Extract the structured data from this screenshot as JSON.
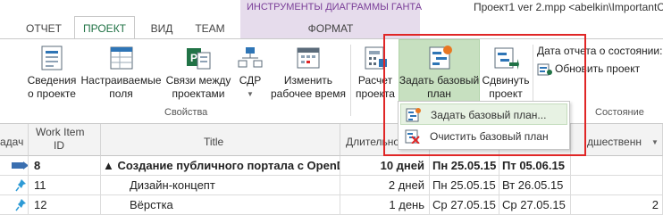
{
  "context_tab_header": "ИНСТРУМЕНТЫ ДИАГРАММЫ ГАНТА",
  "window_title": "Проект1 ver 2.mpp <abelkin\\ImportantCollec",
  "tabs": [
    {
      "label": "ОТЧЕТ"
    },
    {
      "label": "ПРОЕКТ",
      "active": true
    },
    {
      "label": "ВИД"
    },
    {
      "label": "TEAM"
    },
    {
      "label": "ФОРМАТ"
    }
  ],
  "ribbon": {
    "buttons": {
      "project_info": [
        "Сведения",
        "о проекте"
      ],
      "custom_fields": [
        "Настраиваемые",
        "поля"
      ],
      "links_between": [
        "Связи между",
        "проектами"
      ],
      "wbs": [
        "СДР"
      ],
      "change_worktime": [
        "Изменить",
        "рабочее время"
      ],
      "calc_project": [
        "Расчет",
        "проекта"
      ],
      "set_baseline": [
        "Задать базовый",
        "план"
      ],
      "move_project": [
        "Сдвинуть",
        "проект"
      ]
    },
    "group_properties": "Свойства",
    "group_status": "Состояние",
    "status_date_label": "Дата отчета о состоянии:",
    "update_project": "Обновить проект"
  },
  "dropdown": {
    "items": [
      {
        "label": "Задать базовый план...",
        "hover": true
      },
      {
        "label": "Очистить базовый план"
      }
    ]
  },
  "grid": {
    "headers": {
      "col0": "адач",
      "work_item": [
        "Work Item",
        "ID"
      ],
      "title": "Title",
      "duration": "Длительно",
      "right": "дшественн"
    },
    "rows": [
      {
        "work_item_id": "8",
        "title": "▲ Создание публичного портала с OpenD",
        "duration": "10 дней",
        "start": "Пн 25.05.15",
        "finish": "Пт 05.06.15",
        "pred": "",
        "summary": true
      },
      {
        "work_item_id": "11",
        "title": "Дизайн-концепт",
        "duration": "2 дней",
        "start": "Пн 25.05.15",
        "finish": "Вт 26.05.15",
        "pred": ""
      },
      {
        "work_item_id": "12",
        "title": "Вёрстка",
        "duration": "1 день",
        "start": "Ср 27.05.15",
        "finish": "Ср 27.05.15",
        "pred": "2"
      }
    ]
  },
  "colors": {
    "accent_green": "#217346",
    "context_tab": "#e6dcec",
    "context_text": "#7a3e98",
    "highlight_red": "#e02626",
    "baseline_button": "#c7e0c0"
  }
}
